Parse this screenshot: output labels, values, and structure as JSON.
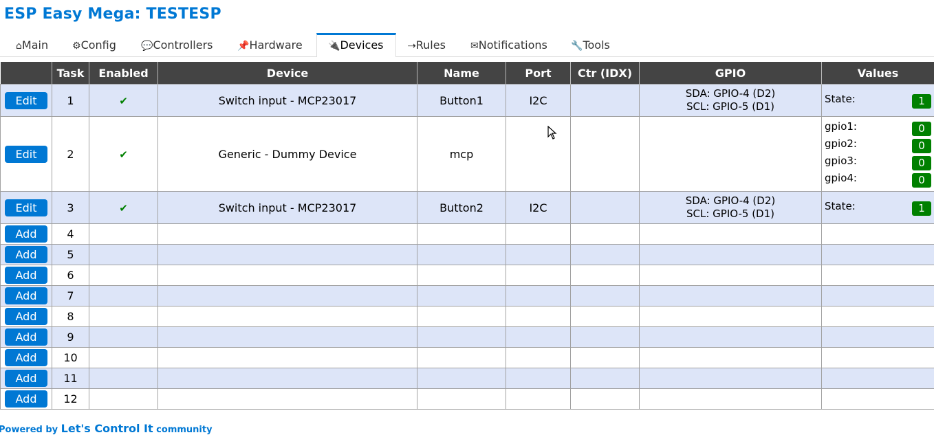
{
  "app": {
    "title": "ESP Easy Mega: TESTESP"
  },
  "menu": {
    "tabs": [
      {
        "icon": "⌂",
        "label": "Main"
      },
      {
        "icon": "⚙",
        "label": "Config"
      },
      {
        "icon": "💬",
        "label": "Controllers"
      },
      {
        "icon": "📌",
        "label": "Hardware"
      },
      {
        "icon": "🔌",
        "label": "Devices"
      },
      {
        "icon": "⇢",
        "label": "Rules"
      },
      {
        "icon": "✉",
        "label": "Notifications"
      },
      {
        "icon": "🔧",
        "label": "Tools"
      }
    ],
    "active": "Devices"
  },
  "table": {
    "headers": [
      "",
      "Task",
      "Enabled",
      "Device",
      "Name",
      "Port",
      "Ctr (IDX)",
      "GPIO",
      "Values"
    ],
    "rows": [
      {
        "button": "Edit",
        "task": "1",
        "enabled": "✔",
        "device": "Switch input - MCP23017",
        "name": "Button1",
        "port": "I2C",
        "ctr": "",
        "gpio": [
          "SDA: GPIO-4 (D2)",
          "SCL: GPIO-5 (D1)"
        ],
        "values": [
          {
            "label": "State:",
            "value": "1"
          }
        ]
      },
      {
        "button": "Edit",
        "task": "2",
        "enabled": "✔",
        "device": "Generic - Dummy Device",
        "name": "mcp",
        "port": "",
        "ctr": "",
        "gpio": [],
        "values": [
          {
            "label": "gpio1:",
            "value": "0"
          },
          {
            "label": "gpio2:",
            "value": "0"
          },
          {
            "label": "gpio3:",
            "value": "0"
          },
          {
            "label": "gpio4:",
            "value": "0"
          }
        ]
      },
      {
        "button": "Edit",
        "task": "3",
        "enabled": "✔",
        "device": "Switch input - MCP23017",
        "name": "Button2",
        "port": "I2C",
        "ctr": "",
        "gpio": [
          "SDA: GPIO-4 (D2)",
          "SCL: GPIO-5 (D1)"
        ],
        "values": [
          {
            "label": "State:",
            "value": "1"
          }
        ]
      },
      {
        "button": "Add",
        "task": "4"
      },
      {
        "button": "Add",
        "task": "5"
      },
      {
        "button": "Add",
        "task": "6"
      },
      {
        "button": "Add",
        "task": "7"
      },
      {
        "button": "Add",
        "task": "8"
      },
      {
        "button": "Add",
        "task": "9"
      },
      {
        "button": "Add",
        "task": "10"
      },
      {
        "button": "Add",
        "task": "11"
      },
      {
        "button": "Add",
        "task": "12"
      }
    ]
  },
  "footer": {
    "prefix": "Powered by ",
    "link": "Let's Control It",
    "suffix": " community"
  },
  "colors": {
    "accent": "#0078d4",
    "header_bg": "#444444",
    "row_alt": "#dde5f8",
    "badge": "#008000"
  }
}
